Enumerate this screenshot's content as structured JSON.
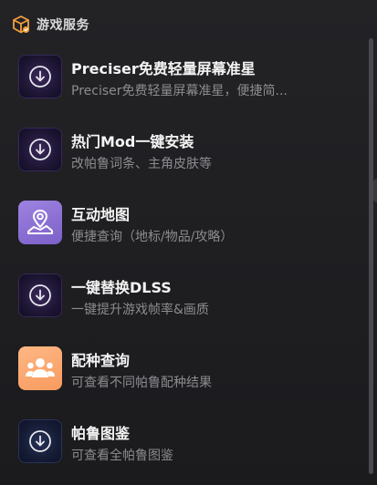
{
  "section": {
    "title": "游戏服务",
    "icon": "package-icon"
  },
  "colors": {
    "accent_orange": "#f2a03c",
    "title_text": "#f4f4f4",
    "desc_text": "#8c8c90"
  },
  "services": [
    {
      "title": "Preciser免费轻量屏幕准星",
      "desc": "Preciser免费轻量屏幕准星，便捷简...",
      "icon": "download-circle-icon"
    },
    {
      "title": "热门Mod一键安装",
      "desc": "改帕鲁词条、主角皮肤等",
      "icon": "download-circle-icon"
    },
    {
      "title": "互动地图",
      "desc": "便捷查询（地标/物品/攻略）",
      "icon": "map-pin-icon"
    },
    {
      "title": "一键替换DLSS",
      "desc": "一键提升游戏帧率&画质",
      "icon": "download-circle-icon"
    },
    {
      "title": "配种查询",
      "desc": "可查看不同帕鲁配种结果",
      "icon": "group-users-icon"
    },
    {
      "title": "帕鲁图鉴",
      "desc": "可查看全帕鲁图鉴",
      "icon": "download-circle-icon"
    }
  ]
}
